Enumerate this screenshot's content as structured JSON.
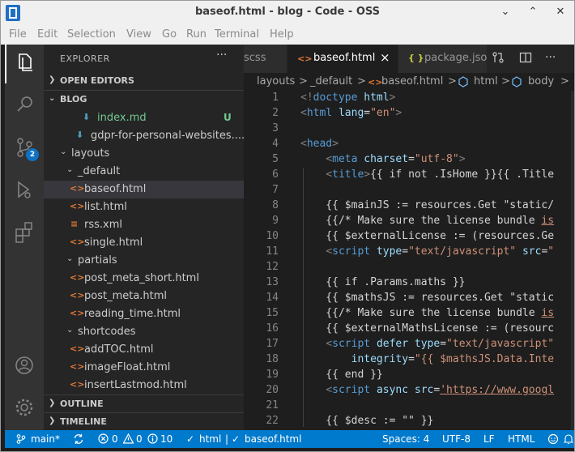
{
  "window": {
    "title": "baseof.html - blog - Code - OSS",
    "minimize_glyph": "⌄",
    "maximize_glyph": "⌃",
    "close_glyph": "✕"
  },
  "menu": [
    "File",
    "Edit",
    "Selection",
    "View",
    "Go",
    "Run",
    "Terminal",
    "Help"
  ],
  "activity_bar": {
    "icons": [
      "explorer-icon",
      "search-icon",
      "source-control-icon",
      "run-debug-icon",
      "extensions-icon",
      "account-icon",
      "settings-gear-icon"
    ],
    "scm_badge": "2"
  },
  "sidebar": {
    "title": "EXPLORER",
    "more": "···",
    "open_editors": "OPEN EDITORS",
    "workspace": "BLOG",
    "outline": "OUTLINE",
    "timeline": "TIMELINE",
    "tree": [
      {
        "name": "index.md",
        "icon": "download-arrow-icon",
        "glyph": "⬇",
        "status": "U",
        "untracked": true
      },
      {
        "name": "gdpr-for-personal-websites....",
        "icon": "download-arrow-icon",
        "glyph": "⬇"
      },
      {
        "name": "layouts",
        "chevron": "⌄"
      },
      {
        "name": "_default",
        "chevron": "⌄"
      },
      {
        "name": "baseof.html",
        "icon": "html-icon",
        "glyph": "<>",
        "selected": true
      },
      {
        "name": "list.html",
        "icon": "html-icon",
        "glyph": "<>"
      },
      {
        "name": "rss.xml",
        "icon": "rss-icon",
        "glyph": "≡"
      },
      {
        "name": "single.html",
        "icon": "html-icon",
        "glyph": "<>"
      },
      {
        "name": "partials",
        "chevron": "⌄"
      },
      {
        "name": "post_meta_short.html",
        "icon": "html-icon",
        "glyph": "<>"
      },
      {
        "name": "post_meta.html",
        "icon": "html-icon",
        "glyph": "<>"
      },
      {
        "name": "reading_time.html",
        "icon": "html-icon",
        "glyph": "<>"
      },
      {
        "name": "shortcodes",
        "chevron": "⌄"
      },
      {
        "name": "addTOC.html",
        "icon": "html-icon",
        "glyph": "<>"
      },
      {
        "name": "imageFloat.html",
        "icon": "html-icon",
        "glyph": "<>"
      },
      {
        "name": "insertLastmod.html",
        "icon": "html-icon",
        "glyph": "<>"
      }
    ]
  },
  "tabs": [
    {
      "label": "scss",
      "active": false
    },
    {
      "label": "baseof.html",
      "icon": "<>",
      "close": "×",
      "active": true
    },
    {
      "label": "package.jso",
      "icon": "{ }",
      "active": false
    }
  ],
  "breadcrumb": [
    "layouts",
    ">",
    "_default",
    ">",
    "<>",
    "baseof.html",
    ">",
    "html",
    ">",
    "body",
    ">"
  ],
  "code_lines": [
    {
      "n": "1",
      "html": "<span class='g'>&lt;!</span><span class='k'>doctype</span> <span class='a'>html</span><span class='g'>&gt;</span>"
    },
    {
      "n": "2",
      "html": "<span class='g'>&lt;</span><span class='k'>html</span> <span class='a'>lang</span>=<span class='s'>\"en\"</span><span class='g'>&gt;</span>"
    },
    {
      "n": "3",
      "html": ""
    },
    {
      "n": "4",
      "html": "<span class='g'>&lt;</span><span class='k'>head</span><span class='g'>&gt;</span>"
    },
    {
      "n": "5",
      "html": "    <span class='g'>&lt;</span><span class='k'>meta</span> <span class='a'>charset</span>=<span class='s'>\"utf-8\"</span><span class='g'>&gt;</span>"
    },
    {
      "n": "6",
      "html": "    <span class='g'>&lt;</span><span class='k'>title</span><span class='g'>&gt;</span>{{ if not .IsHome }}{{ .Title"
    },
    {
      "n": "7",
      "html": ""
    },
    {
      "n": "8",
      "html": "    {{ $mainJS := resources.Get \"static/"
    },
    {
      "n": "9",
      "html": "    {{/* Make sure the license bundle <span class='lnk'>is</span>"
    },
    {
      "n": "10",
      "html": "    {{ $externalLicense := (resources.Ge"
    },
    {
      "n": "11",
      "html": "    <span class='g'>&lt;</span><span class='k'>script</span> <span class='a'>type</span>=<span class='s'>\"text/javascript\"</span> <span class='a'>src</span>=<span class='s'>\"</span>"
    },
    {
      "n": "12",
      "html": ""
    },
    {
      "n": "13",
      "html": "    {{ if .Params.maths }}"
    },
    {
      "n": "14",
      "html": "    {{ $mathsJS := resources.Get \"static"
    },
    {
      "n": "15",
      "html": "    {{/* Make sure the license bundle <span class='lnk'>is</span>"
    },
    {
      "n": "16",
      "html": "    {{ $externalMathsLicense := (resourc"
    },
    {
      "n": "17",
      "html": "    <span class='g'>&lt;</span><span class='k'>script</span> <span class='a'>defer</span> <span class='a'>type</span>=<span class='s'>\"text/javascript\"</span>"
    },
    {
      "n": "18",
      "html": "        <span class='a'>integrity</span>=<span class='s'>\"{{ $mathsJS.Data.Inte</span>"
    },
    {
      "n": "19",
      "html": "    {{ end }}"
    },
    {
      "n": "20",
      "html": "    <span class='g'>&lt;</span><span class='k'>script</span> <span class='a'>async</span> <span class='a'>src</span>=<span class='lnk'>'https://www.googl</span>"
    },
    {
      "n": "21",
      "html": ""
    },
    {
      "n": "22",
      "html": "    {{ $desc := \"\" }}"
    }
  ],
  "status_bar": {
    "branch": "main*",
    "errors": "0",
    "warnings": "0",
    "info": "10",
    "lang_crumb": "html",
    "file_crumb": "baseof.html",
    "spaces": "Spaces: 4",
    "encoding": "UTF-8",
    "eol": "LF",
    "language": "HTML"
  },
  "colors": {
    "status_bar": "#007acc",
    "activity_bar": "#333333",
    "sidebar": "#252526",
    "editor": "#1e1e1e",
    "selected_row": "#37373d",
    "untracked": "#73c991"
  }
}
